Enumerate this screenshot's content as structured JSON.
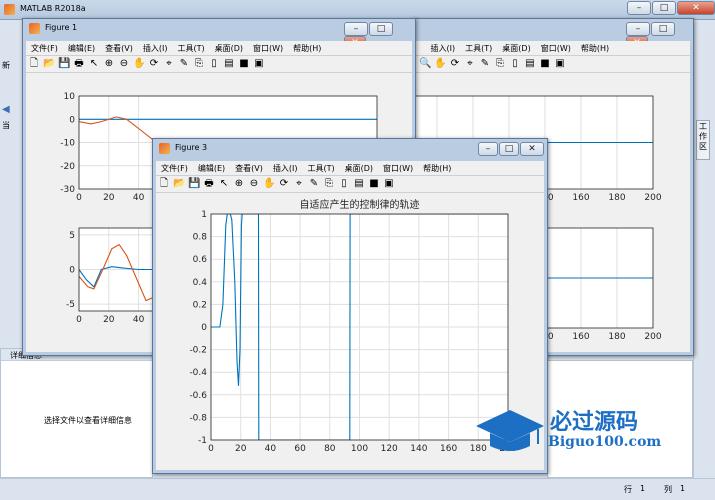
{
  "matlab": {
    "title": "MATLAB R2018a"
  },
  "left_strip": {
    "item1": "新",
    "item2": "当",
    "detail_title": "详细信息",
    "detail_text": "选择文件以查看详细信息"
  },
  "right_strip": {
    "label": "工作区"
  },
  "status": {
    "row_label": "行",
    "row_value": "1",
    "col_label": "列",
    "col_value": "1"
  },
  "watermark": {
    "title": "必过源码",
    "url": "Biguo100.com"
  },
  "menu": [
    "文件(F)",
    "编辑(E)",
    "查看(V)",
    "插入(I)",
    "工具(T)",
    "桌面(D)",
    "窗口(W)",
    "帮助(H)"
  ],
  "menu_back": [
    "插入(I)",
    "工具(T)",
    "桌面(D)",
    "窗口(W)",
    "帮助(H)"
  ],
  "fig1": {
    "title": "Figure 1"
  },
  "fig3": {
    "title": "Figure 3"
  },
  "chart_data": [
    {
      "type": "line",
      "title": "自适应产生的控制律的轨迹",
      "xlim": [
        0,
        200
      ],
      "ylim": [
        -1,
        1
      ],
      "xticks": [
        0,
        20,
        40,
        60,
        80,
        100,
        120,
        140,
        160,
        180,
        200
      ],
      "yticks": [
        1,
        0.8,
        0.6,
        0.4,
        0.2,
        0,
        -0.2,
        -0.4,
        -0.6,
        -0.8,
        -1
      ],
      "series": [
        {
          "color": "#0072bd",
          "points": [
            [
              0,
              0
            ],
            [
              6,
              0
            ],
            [
              8,
              0.2
            ],
            [
              10,
              0.9
            ],
            [
              11,
              1
            ],
            [
              13,
              1
            ],
            [
              14,
              0.95
            ],
            [
              16,
              0.4
            ],
            [
              17.5,
              -0.3
            ],
            [
              18.5,
              -0.52
            ],
            [
              19.5,
              -0.2
            ],
            [
              20.5,
              0.9
            ],
            [
              21,
              1
            ],
            [
              32,
              1
            ],
            [
              32.2,
              -1
            ],
            [
              93.5,
              -1
            ],
            [
              93.7,
              1
            ],
            [
              200,
              1
            ]
          ]
        }
      ]
    },
    {
      "type": "line",
      "xlim": [
        0,
        200
      ],
      "ylim": [
        -30,
        10
      ],
      "yticks": [
        10,
        0,
        -10,
        -20,
        -30
      ],
      "xticks": [
        0,
        20,
        40
      ],
      "series": [
        {
          "color": "#0072bd",
          "points": [
            [
              0,
              0
            ],
            [
              200,
              0
            ]
          ]
        },
        {
          "color": "#d95319",
          "points": [
            [
              0,
              -1
            ],
            [
              8,
              -2
            ],
            [
              15,
              -1
            ],
            [
              25,
              1
            ],
            [
              32,
              0
            ],
            [
              40,
              -4
            ],
            [
              50,
              -9
            ],
            [
              60,
              -14
            ],
            [
              70,
              -18
            ]
          ]
        }
      ]
    },
    {
      "type": "line",
      "xlim": [
        0,
        200
      ],
      "ylim": [
        -6,
        6
      ],
      "yticks": [
        5,
        0,
        -5
      ],
      "xticks": [
        0,
        20,
        40
      ],
      "series": [
        {
          "color": "#0072bd",
          "points": [
            [
              0,
              0
            ],
            [
              5,
              -1.5
            ],
            [
              10,
              -2.5
            ],
            [
              15,
              0
            ],
            [
              22,
              0.4
            ],
            [
              30,
              0.2
            ],
            [
              40,
              0
            ],
            [
              70,
              0
            ]
          ]
        },
        {
          "color": "#d95319",
          "points": [
            [
              0,
              -1
            ],
            [
              6,
              -2.5
            ],
            [
              10,
              -2.8
            ],
            [
              16,
              0
            ],
            [
              22,
              3
            ],
            [
              27,
              3.6
            ],
            [
              32,
              2
            ],
            [
              38,
              -1
            ],
            [
              45,
              -4.5
            ],
            [
              50,
              -4
            ]
          ]
        }
      ]
    },
    {
      "type": "line",
      "xlim": [
        0,
        200
      ],
      "xticks": [
        140,
        160,
        180,
        200
      ],
      "series": [
        {
          "color": "#0072bd",
          "points": [
            [
              100,
              0
            ],
            [
              200,
              0
            ]
          ]
        }
      ]
    },
    {
      "type": "line",
      "xlim": [
        0,
        200
      ],
      "xticks": [
        140,
        160,
        180,
        200
      ],
      "series": [
        {
          "color": "#0072bd",
          "points": [
            [
              100,
              0
            ],
            [
              200,
              0
            ]
          ]
        }
      ]
    }
  ]
}
